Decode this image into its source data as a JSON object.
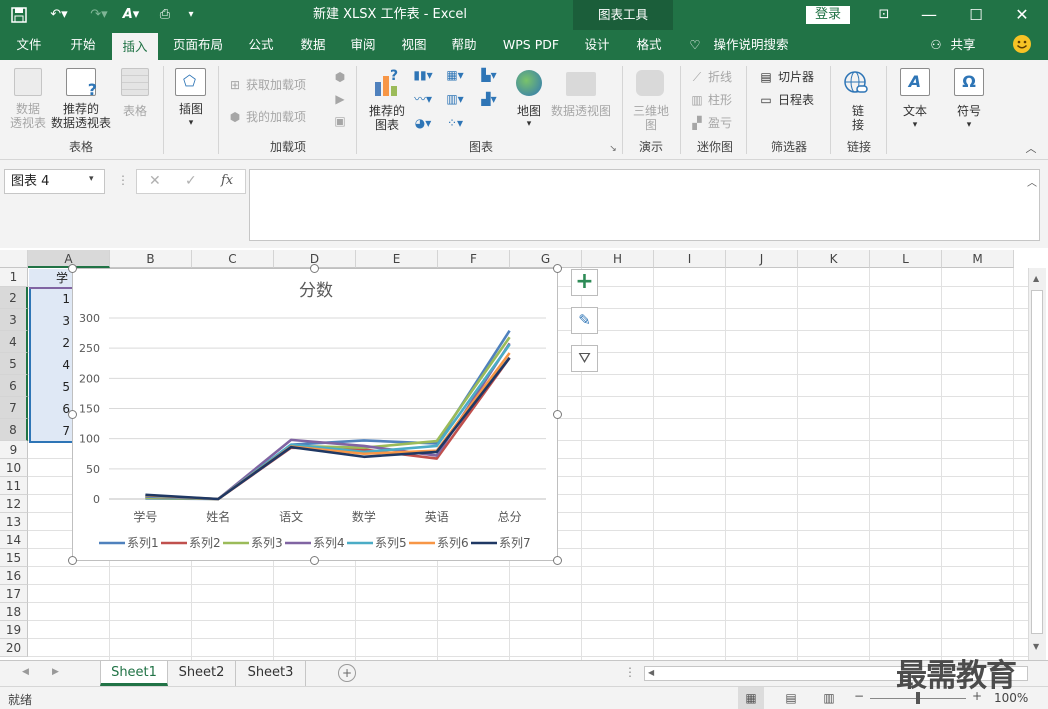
{
  "titlebar": {
    "title": "新建 XLSX 工作表 - Excel",
    "context_tab_group": "图表工具",
    "login_label": "登录"
  },
  "tabs": [
    {
      "label": "文件"
    },
    {
      "label": "开始"
    },
    {
      "label": "插入"
    },
    {
      "label": "页面布局"
    },
    {
      "label": "公式"
    },
    {
      "label": "数据"
    },
    {
      "label": "审阅"
    },
    {
      "label": "视图"
    },
    {
      "label": "帮助"
    },
    {
      "label": "WPS PDF"
    },
    {
      "label": "设计"
    },
    {
      "label": "格式"
    }
  ],
  "search_label": "操作说明搜索",
  "share_label": "共享",
  "ribbon": {
    "pivot_label": "数据\n透视表",
    "rec_pivot_label": "推荐的\n数据透视表",
    "table_label": "表格",
    "group_table": "表格",
    "illustrations_label": "插图",
    "get_addins": "获取加载项",
    "my_addins": "我的加载项",
    "group_addins": "加载项",
    "rec_charts_label": "推荐的\n图表",
    "map_label": "地图",
    "pivot_chart_label": "数据透视图",
    "group_charts": "图表",
    "map3d_label": "三维地\n图",
    "group_tours": "演示",
    "spark_line": "折线",
    "spark_column": "柱形",
    "spark_winloss": "盈亏",
    "group_sparklines": "迷你图",
    "slicer_label": "切片器",
    "timeline_label": "日程表",
    "group_filters": "筛选器",
    "link_label": "链\n接",
    "group_links": "链接",
    "text_label": "文本",
    "symbol_label": "符号"
  },
  "formula_bar": {
    "name_box": "图表 4",
    "fx": "fx",
    "value": ""
  },
  "columns": [
    "A",
    "B",
    "C",
    "D",
    "E",
    "F",
    "G",
    "H",
    "I",
    "J",
    "K",
    "L",
    "M"
  ],
  "rows": [
    "1",
    "2",
    "3",
    "4",
    "5",
    "6",
    "7",
    "8",
    "9",
    "10",
    "11",
    "12",
    "13",
    "14",
    "15",
    "16",
    "17",
    "18",
    "19",
    "20"
  ],
  "cells": {
    "A1": "学",
    "A2": "1",
    "A3": "3",
    "A4": "2",
    "A5": "4",
    "A6": "5",
    "A7": "6",
    "A8": "7"
  },
  "chart_data": {
    "type": "line",
    "title": "分数",
    "categories": [
      "学号",
      "姓名",
      "语文",
      "数学",
      "英语",
      "总分"
    ],
    "ylim": [
      0,
      300
    ],
    "yticks": [
      0,
      50,
      100,
      150,
      200,
      250,
      300
    ],
    "grid": true,
    "legend_position": "bottom",
    "series": [
      {
        "name": "系列1",
        "color": "#4f81bd",
        "values": [
          1,
          0,
          90,
          97,
          92,
          279
        ]
      },
      {
        "name": "系列2",
        "color": "#c0504d",
        "values": [
          3,
          0,
          85,
          82,
          67,
          234
        ]
      },
      {
        "name": "系列3",
        "color": "#9bbb59",
        "values": [
          2,
          0,
          88,
          85,
          96,
          268
        ]
      },
      {
        "name": "系列4",
        "color": "#8064a2",
        "values": [
          4,
          0,
          98,
          88,
          72,
          258
        ]
      },
      {
        "name": "系列5",
        "color": "#4bacc6",
        "values": [
          5,
          0,
          90,
          78,
          88,
          256
        ]
      },
      {
        "name": "系列6",
        "color": "#f79646",
        "values": [
          6,
          0,
          87,
          75,
          80,
          242
        ]
      },
      {
        "name": "系列7",
        "color": "#1f3864",
        "values": [
          7,
          0,
          86,
          70,
          78,
          234
        ]
      }
    ]
  },
  "sheets": [
    {
      "label": "Sheet1"
    },
    {
      "label": "Sheet2"
    },
    {
      "label": "Sheet3"
    }
  ],
  "status": {
    "ready": "就绪",
    "zoom": "100%"
  },
  "watermark": "最需教育"
}
